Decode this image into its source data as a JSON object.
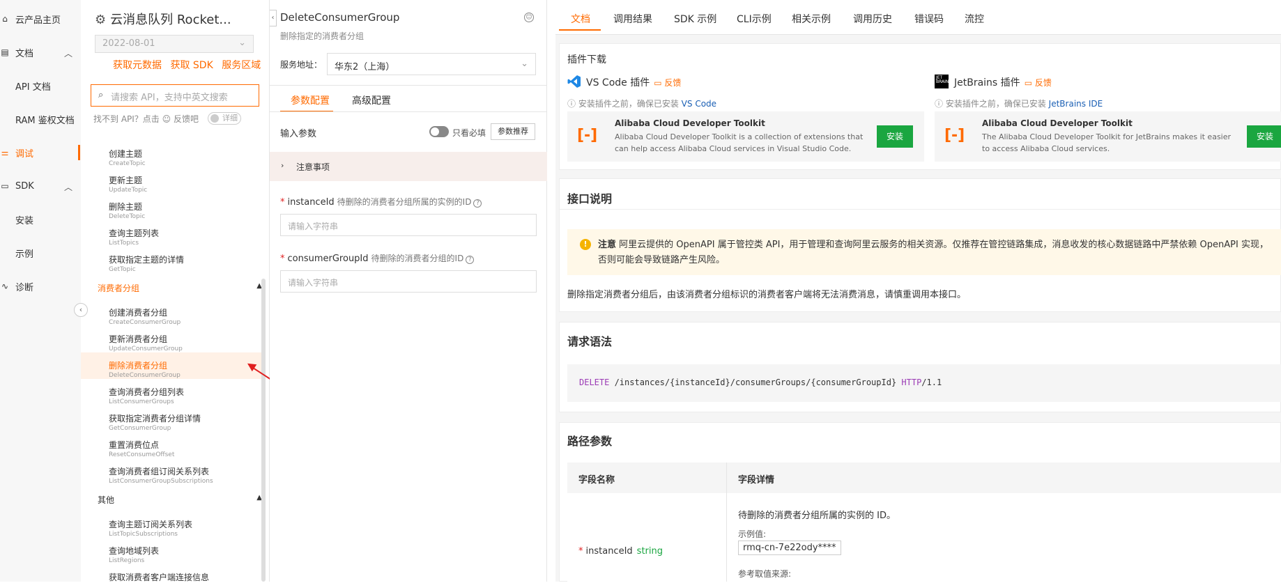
{
  "leftnav": {
    "items": [
      {
        "label": "云产品主页",
        "icon": "home-icon"
      },
      {
        "label": "文档",
        "icon": "document-icon"
      },
      {
        "label": "API 文档"
      },
      {
        "label": "RAM 鉴权文档"
      },
      {
        "label": "调试",
        "icon": "debug-icon"
      },
      {
        "label": "SDK",
        "icon": "sdk-icon"
      },
      {
        "label": "安装"
      },
      {
        "label": "示例"
      },
      {
        "label": "诊断",
        "icon": "diagnose-icon"
      }
    ],
    "accent": "#ff6a00"
  },
  "apilist": {
    "product_title": "云消息队列 Rocket...",
    "version": "2022-08-01",
    "links": [
      "获取元数据",
      "获取 SDK",
      "服务区域"
    ],
    "search_placeholder": "请搜索 API，支持中英文搜索",
    "not_found": "找不到 API？点击 ☺ 反馈吧",
    "detail_toggle": "详细",
    "topic_items": [
      {
        "cn": "创建主题",
        "en": "CreateTopic"
      },
      {
        "cn": "更新主题",
        "en": "UpdateTopic"
      },
      {
        "cn": "删除主题",
        "en": "DeleteTopic"
      },
      {
        "cn": "查询主题列表",
        "en": "ListTopics"
      },
      {
        "cn": "获取指定主题的详情",
        "en": "GetTopic"
      }
    ],
    "group_consumer": "消费者分组",
    "consumer_items": [
      {
        "cn": "创建消费者分组",
        "en": "CreateConsumerGroup"
      },
      {
        "cn": "更新消费者分组",
        "en": "UpdateConsumerGroup"
      },
      {
        "cn": "删除消费者分组",
        "en": "DeleteConsumerGroup"
      },
      {
        "cn": "查询消费者分组列表",
        "en": "ListConsumerGroups"
      },
      {
        "cn": "获取指定消费者分组详情",
        "en": "GetConsumerGroup"
      },
      {
        "cn": "重置消费位点",
        "en": "ResetConsumeOffset"
      },
      {
        "cn": "查询消费者组订阅关系列表",
        "en": "ListConsumerGroupSubscriptions"
      }
    ],
    "group_other": "其他",
    "other_items": [
      {
        "cn": "查询主题订阅关系列表",
        "en": "ListTopicSubscriptions"
      },
      {
        "cn": "查询地域列表",
        "en": "ListRegions"
      },
      {
        "cn": "获取消费者客户端连接信息",
        "en": ""
      }
    ]
  },
  "debug": {
    "api_name": "DeleteConsumerGroup",
    "api_desc": "删除指定的消费者分组",
    "service_label": "服务地址：",
    "service_value": "华东2（上海）",
    "tabs": [
      "参数配置",
      "高级配置"
    ],
    "input_params": "输入参数",
    "only_required": "只看必填",
    "recommend": "参数推荐",
    "notes": "注意事项",
    "params": [
      {
        "name": "instanceId",
        "hint": "待删除的消费者分组所属的实例的ID",
        "placeholder": "请输入字符串"
      },
      {
        "name": "consumerGroupId",
        "hint": "待删除的消费者分组的ID",
        "placeholder": "请输入字符串"
      }
    ]
  },
  "docs": {
    "tabs": [
      "文档",
      "调用结果",
      "SDK 示例",
      "CLI示例",
      "相关示例",
      "调用历史",
      "错误码",
      "流控"
    ],
    "plugin_title": "插件下载",
    "vs_name": "VS Code 插件",
    "jb_name": "JetBrains 插件",
    "feedback": "反馈",
    "install_hint": "安装插件之前，确保已安装",
    "vs_link": "VS Code",
    "jb_link": "JetBrains IDE",
    "tool_name": "Alibaba Cloud Developer Toolkit",
    "vs_tool_desc": "Alibaba Cloud Developer Toolkit is a collection of extensions that can help access Alibaba Cloud services in Visual Studio Code.",
    "jb_tool_desc": "The Alibaba Cloud Developer Toolkit for JetBrains makes it easier to access Alibaba Cloud services.",
    "install_btn": "安装",
    "jb_logo_text": "JET BRAINS",
    "sec_api": "接口说明",
    "notice_bold": "注意",
    "notice_text": "阿里云提供的 OpenAPI 属于管控类 API，用于管理和查询阿里云服务的相关资源。仅推荐在管控链路集成，消息收发的核心数据链路中严禁依赖 OpenAPI 实现，否则可能会导致链路产生风险。",
    "desc": "删除指定消费者分组后，由该消费者分组标识的消费者客户端将无法消费消息，请慎重调用本接口。",
    "sec_syntax": "请求语法",
    "code_method": "DELETE",
    "code_path": " /instances/{instanceId}/consumerGroups/{consumerGroupId} ",
    "code_proto": "HTTP",
    "code_ver": "/1.1",
    "sec_path": "路径参数",
    "tbl_col1": "字段名称",
    "tbl_col2": "字段详情",
    "field_name": "instanceId",
    "field_type": "string",
    "field_desc": "待删除的消费者分组所属的实例的 ID。",
    "example_label": "示例值:",
    "example_value": "rmq-cn-7e22ody****",
    "ref_label": "参考取值来源:"
  }
}
